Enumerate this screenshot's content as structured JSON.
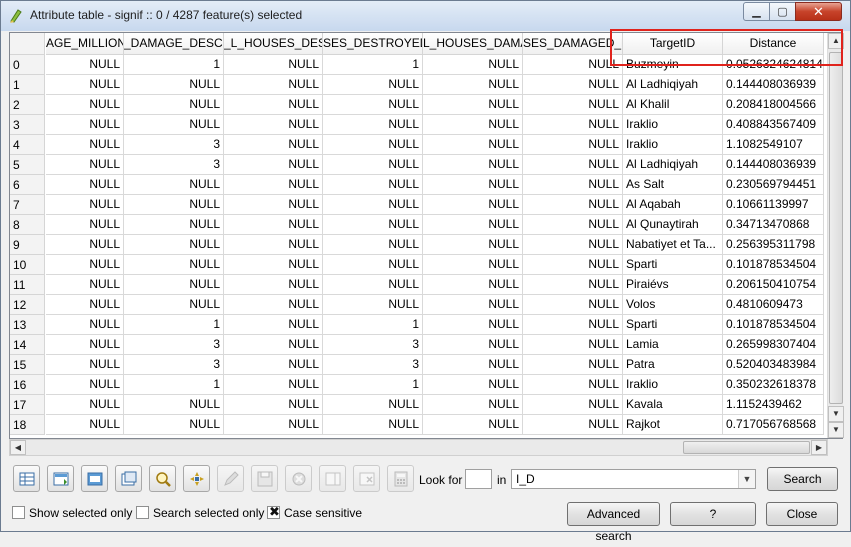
{
  "window": {
    "title": "Attribute table - signif :: 0 / 4287 feature(s) selected",
    "minimize_glyph": "▁",
    "maximize_glyph": "▢",
    "close_glyph": "✕"
  },
  "table": {
    "columns": [
      "AGE_MILLIONS_",
      "_DAMAGE_DESCR",
      "_L_HOUSES_DESTR",
      "SES_DESTROYED_D",
      "L_HOUSES_DAMA",
      "SES_DAMAGED_D",
      "TargetID",
      "Distance"
    ],
    "rows": [
      {
        "id": "0",
        "c": [
          "NULL",
          "1",
          "NULL",
          "1",
          "NULL",
          "NULL",
          "Buzmeyin",
          "0.0526324624814"
        ]
      },
      {
        "id": "1",
        "c": [
          "NULL",
          "NULL",
          "NULL",
          "NULL",
          "NULL",
          "NULL",
          "Al Ladhiqiyah",
          "0.144408036939"
        ]
      },
      {
        "id": "2",
        "c": [
          "NULL",
          "NULL",
          "NULL",
          "NULL",
          "NULL",
          "NULL",
          "Al Khalil",
          "0.208418004566"
        ]
      },
      {
        "id": "3",
        "c": [
          "NULL",
          "NULL",
          "NULL",
          "NULL",
          "NULL",
          "NULL",
          "Iraklio",
          "0.408843567409"
        ]
      },
      {
        "id": "4",
        "c": [
          "NULL",
          "3",
          "NULL",
          "NULL",
          "NULL",
          "NULL",
          "Iraklio",
          "1.1082549107"
        ]
      },
      {
        "id": "5",
        "c": [
          "NULL",
          "3",
          "NULL",
          "NULL",
          "NULL",
          "NULL",
          "Al Ladhiqiyah",
          "0.144408036939"
        ]
      },
      {
        "id": "6",
        "c": [
          "NULL",
          "NULL",
          "NULL",
          "NULL",
          "NULL",
          "NULL",
          "As Salt",
          "0.230569794451"
        ]
      },
      {
        "id": "7",
        "c": [
          "NULL",
          "NULL",
          "NULL",
          "NULL",
          "NULL",
          "NULL",
          "Al Aqabah",
          "0.10661139997"
        ]
      },
      {
        "id": "8",
        "c": [
          "NULL",
          "NULL",
          "NULL",
          "NULL",
          "NULL",
          "NULL",
          "Al Qunaytirah",
          "0.34713470868"
        ]
      },
      {
        "id": "9",
        "c": [
          "NULL",
          "NULL",
          "NULL",
          "NULL",
          "NULL",
          "NULL",
          "Nabatiyet et Ta...",
          "0.256395311798"
        ]
      },
      {
        "id": "10",
        "c": [
          "NULL",
          "NULL",
          "NULL",
          "NULL",
          "NULL",
          "NULL",
          "Sparti",
          "0.101878534504"
        ]
      },
      {
        "id": "11",
        "c": [
          "NULL",
          "NULL",
          "NULL",
          "NULL",
          "NULL",
          "NULL",
          "Piraiévs",
          "0.206150410754"
        ]
      },
      {
        "id": "12",
        "c": [
          "NULL",
          "NULL",
          "NULL",
          "NULL",
          "NULL",
          "NULL",
          "Volos",
          "0.4810609473"
        ]
      },
      {
        "id": "13",
        "c": [
          "NULL",
          "1",
          "NULL",
          "1",
          "NULL",
          "NULL",
          "Sparti",
          "0.101878534504"
        ]
      },
      {
        "id": "14",
        "c": [
          "NULL",
          "3",
          "NULL",
          "3",
          "NULL",
          "NULL",
          "Lamia",
          "0.265998307404"
        ]
      },
      {
        "id": "15",
        "c": [
          "NULL",
          "3",
          "NULL",
          "3",
          "NULL",
          "NULL",
          "Patra",
          "0.520403483984"
        ]
      },
      {
        "id": "16",
        "c": [
          "NULL",
          "1",
          "NULL",
          "1",
          "NULL",
          "NULL",
          "Iraklio",
          "0.350232618378"
        ]
      },
      {
        "id": "17",
        "c": [
          "NULL",
          "NULL",
          "NULL",
          "NULL",
          "NULL",
          "NULL",
          "Kavala",
          "1.1152439462"
        ]
      },
      {
        "id": "18",
        "c": [
          "NULL",
          "NULL",
          "NULL",
          "NULL",
          "NULL",
          "NULL",
          "Rajkot",
          "0.717056768568"
        ]
      }
    ]
  },
  "search": {
    "look_for_label": "Look for",
    "look_for_value": "",
    "in_label": "in",
    "field_selected": "I_D",
    "search_button": "Search",
    "advanced_search_button": "Advanced search",
    "help_button": "?",
    "close_button": "Close"
  },
  "options": {
    "show_selected_only": {
      "label": "Show selected only",
      "checked": false
    },
    "search_selected_only": {
      "label": "Search selected only",
      "checked": false
    },
    "case_sensitive": {
      "label": "Case sensitive",
      "checked": true,
      "mark": "✖"
    }
  },
  "toolbar_icons": [
    "unselect-all-icon",
    "selection-to-top-icon",
    "invert-selection-icon",
    "copy-selected-rows-icon",
    "zoom-to-selection-icon",
    "pan-to-selection-icon",
    "toggle-editing-icon",
    "save-edits-icon",
    "delete-selected-icon",
    "new-column-icon",
    "delete-column-icon",
    "field-calculator-icon"
  ]
}
